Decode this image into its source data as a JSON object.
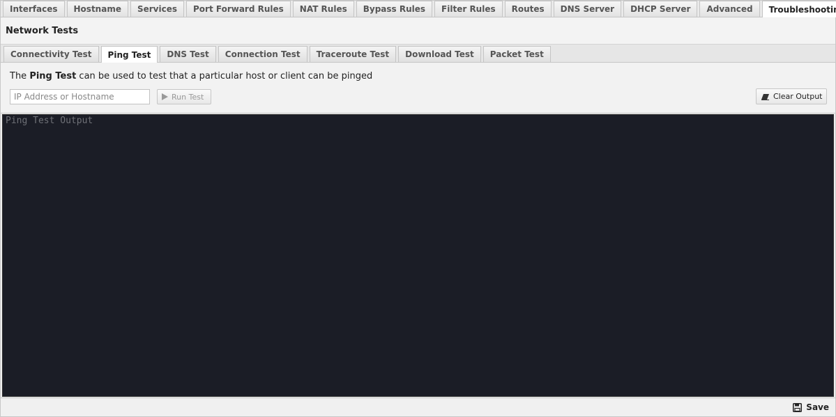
{
  "top_tabs": [
    {
      "label": "Interfaces"
    },
    {
      "label": "Hostname"
    },
    {
      "label": "Services"
    },
    {
      "label": "Port Forward Rules"
    },
    {
      "label": "NAT Rules"
    },
    {
      "label": "Bypass Rules"
    },
    {
      "label": "Filter Rules"
    },
    {
      "label": "Routes"
    },
    {
      "label": "DNS Server"
    },
    {
      "label": "DHCP Server"
    },
    {
      "label": "Advanced"
    },
    {
      "label": "Troubleshooting"
    }
  ],
  "top_tab_active": "Troubleshooting",
  "section": {
    "title": "Network Tests"
  },
  "sub_tabs": [
    {
      "label": "Connectivity Test"
    },
    {
      "label": "Ping Test"
    },
    {
      "label": "DNS Test"
    },
    {
      "label": "Connection Test"
    },
    {
      "label": "Traceroute Test"
    },
    {
      "label": "Download Test"
    },
    {
      "label": "Packet Test"
    }
  ],
  "sub_tab_active": "Ping Test",
  "description": {
    "prefix": "The ",
    "bold": "Ping Test",
    "suffix": " can be used to test that a particular host or client can be pinged"
  },
  "host_input": {
    "value": "",
    "placeholder": "IP Address or Hostname"
  },
  "buttons": {
    "run_test": "Run Test",
    "clear_output": "Clear Output",
    "save": "Save"
  },
  "console": {
    "placeholder": "Ping Test Output"
  },
  "icons": {
    "run": "play-icon",
    "clear": "eraser-icon",
    "save": "floppy-disk-icon"
  },
  "colors": {
    "console_bg": "#1b1d26",
    "console_text": "#6f7177"
  }
}
